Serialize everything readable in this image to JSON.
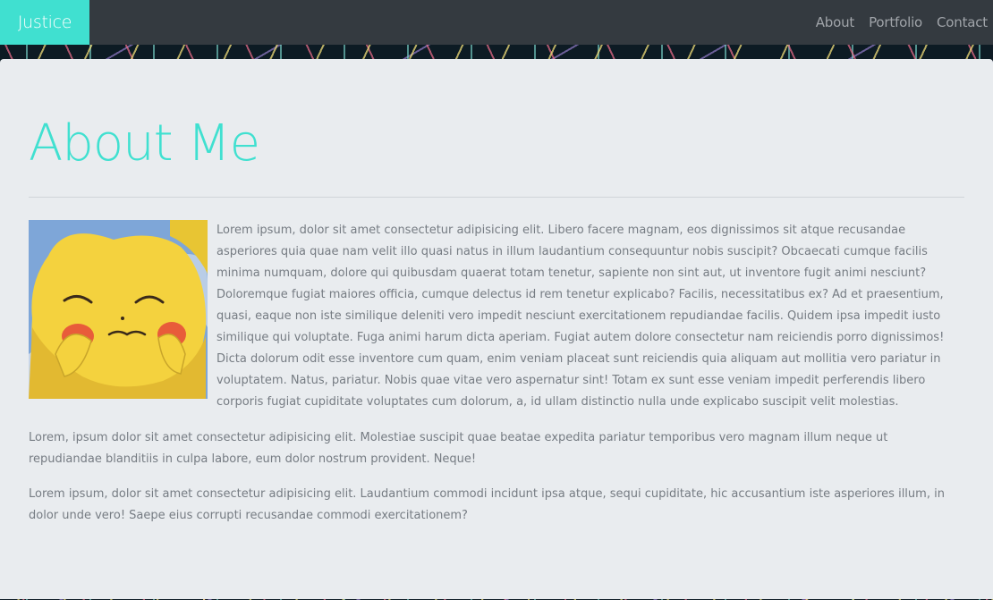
{
  "navbar": {
    "brand": "Justice",
    "links": [
      "About",
      "Portfolio",
      "Contact"
    ]
  },
  "main": {
    "title": "About Me",
    "image_alt": "Pikachu",
    "paragraphs": [
      "Lorem ipsum, dolor sit amet consectetur adipisicing elit. Libero facere magnam, eos dignissimos sit atque recusandae asperiores quia quae nam velit illo quasi natus in illum laudantium consequuntur nobis suscipit? Obcaecati cumque facilis minima numquam, dolore qui quibusdam quaerat totam tenetur, sapiente non sint aut, ut inventore fugit animi nesciunt? Doloremque fugiat maiores officia, cumque delectus id rem tenetur explicabo? Facilis, necessitatibus ex? Ad et praesentium, quasi, eaque non iste similique deleniti vero impedit nesciunt exercitationem repudiandae facilis. Quidem ipsa impedit iusto similique qui voluptate. Fuga animi harum dicta aperiam. Fugiat autem dolore consectetur nam reiciendis porro dignissimos! Dicta dolorum odit esse inventore cum quam, enim veniam placeat sunt reiciendis quia aliquam aut mollitia vero pariatur in voluptatem. Natus, pariatur. Nobis quae vitae vero aspernatur sint! Totam ex sunt esse veniam impedit perferendis libero corporis fugiat cupiditate voluptates cum dolorum, a, id ullam distinctio nulla unde explicabo suscipit velit molestias.",
      "Lorem, ipsum dolor sit amet consectetur adipisicing elit. Molestiae suscipit quae beatae expedita pariatur temporibus vero magnam illum neque ut repudiandae blanditiis in culpa labore, eum dolor nostrum provident. Neque!",
      "Lorem ipsum, dolor sit amet consectetur adipisicing elit. Laudantium commodi incidunt ipsa atque, sequi cupiditate, hic accusantium iste asperiores illum, in dolor unde vero! Saepe eius corrupti recusandae commodi exercitationem?"
    ]
  },
  "colors": {
    "accent": "#40e0d0",
    "navbar_bg": "#343a40",
    "card_bg": "#e9ecef",
    "body_text": "#767c83"
  }
}
